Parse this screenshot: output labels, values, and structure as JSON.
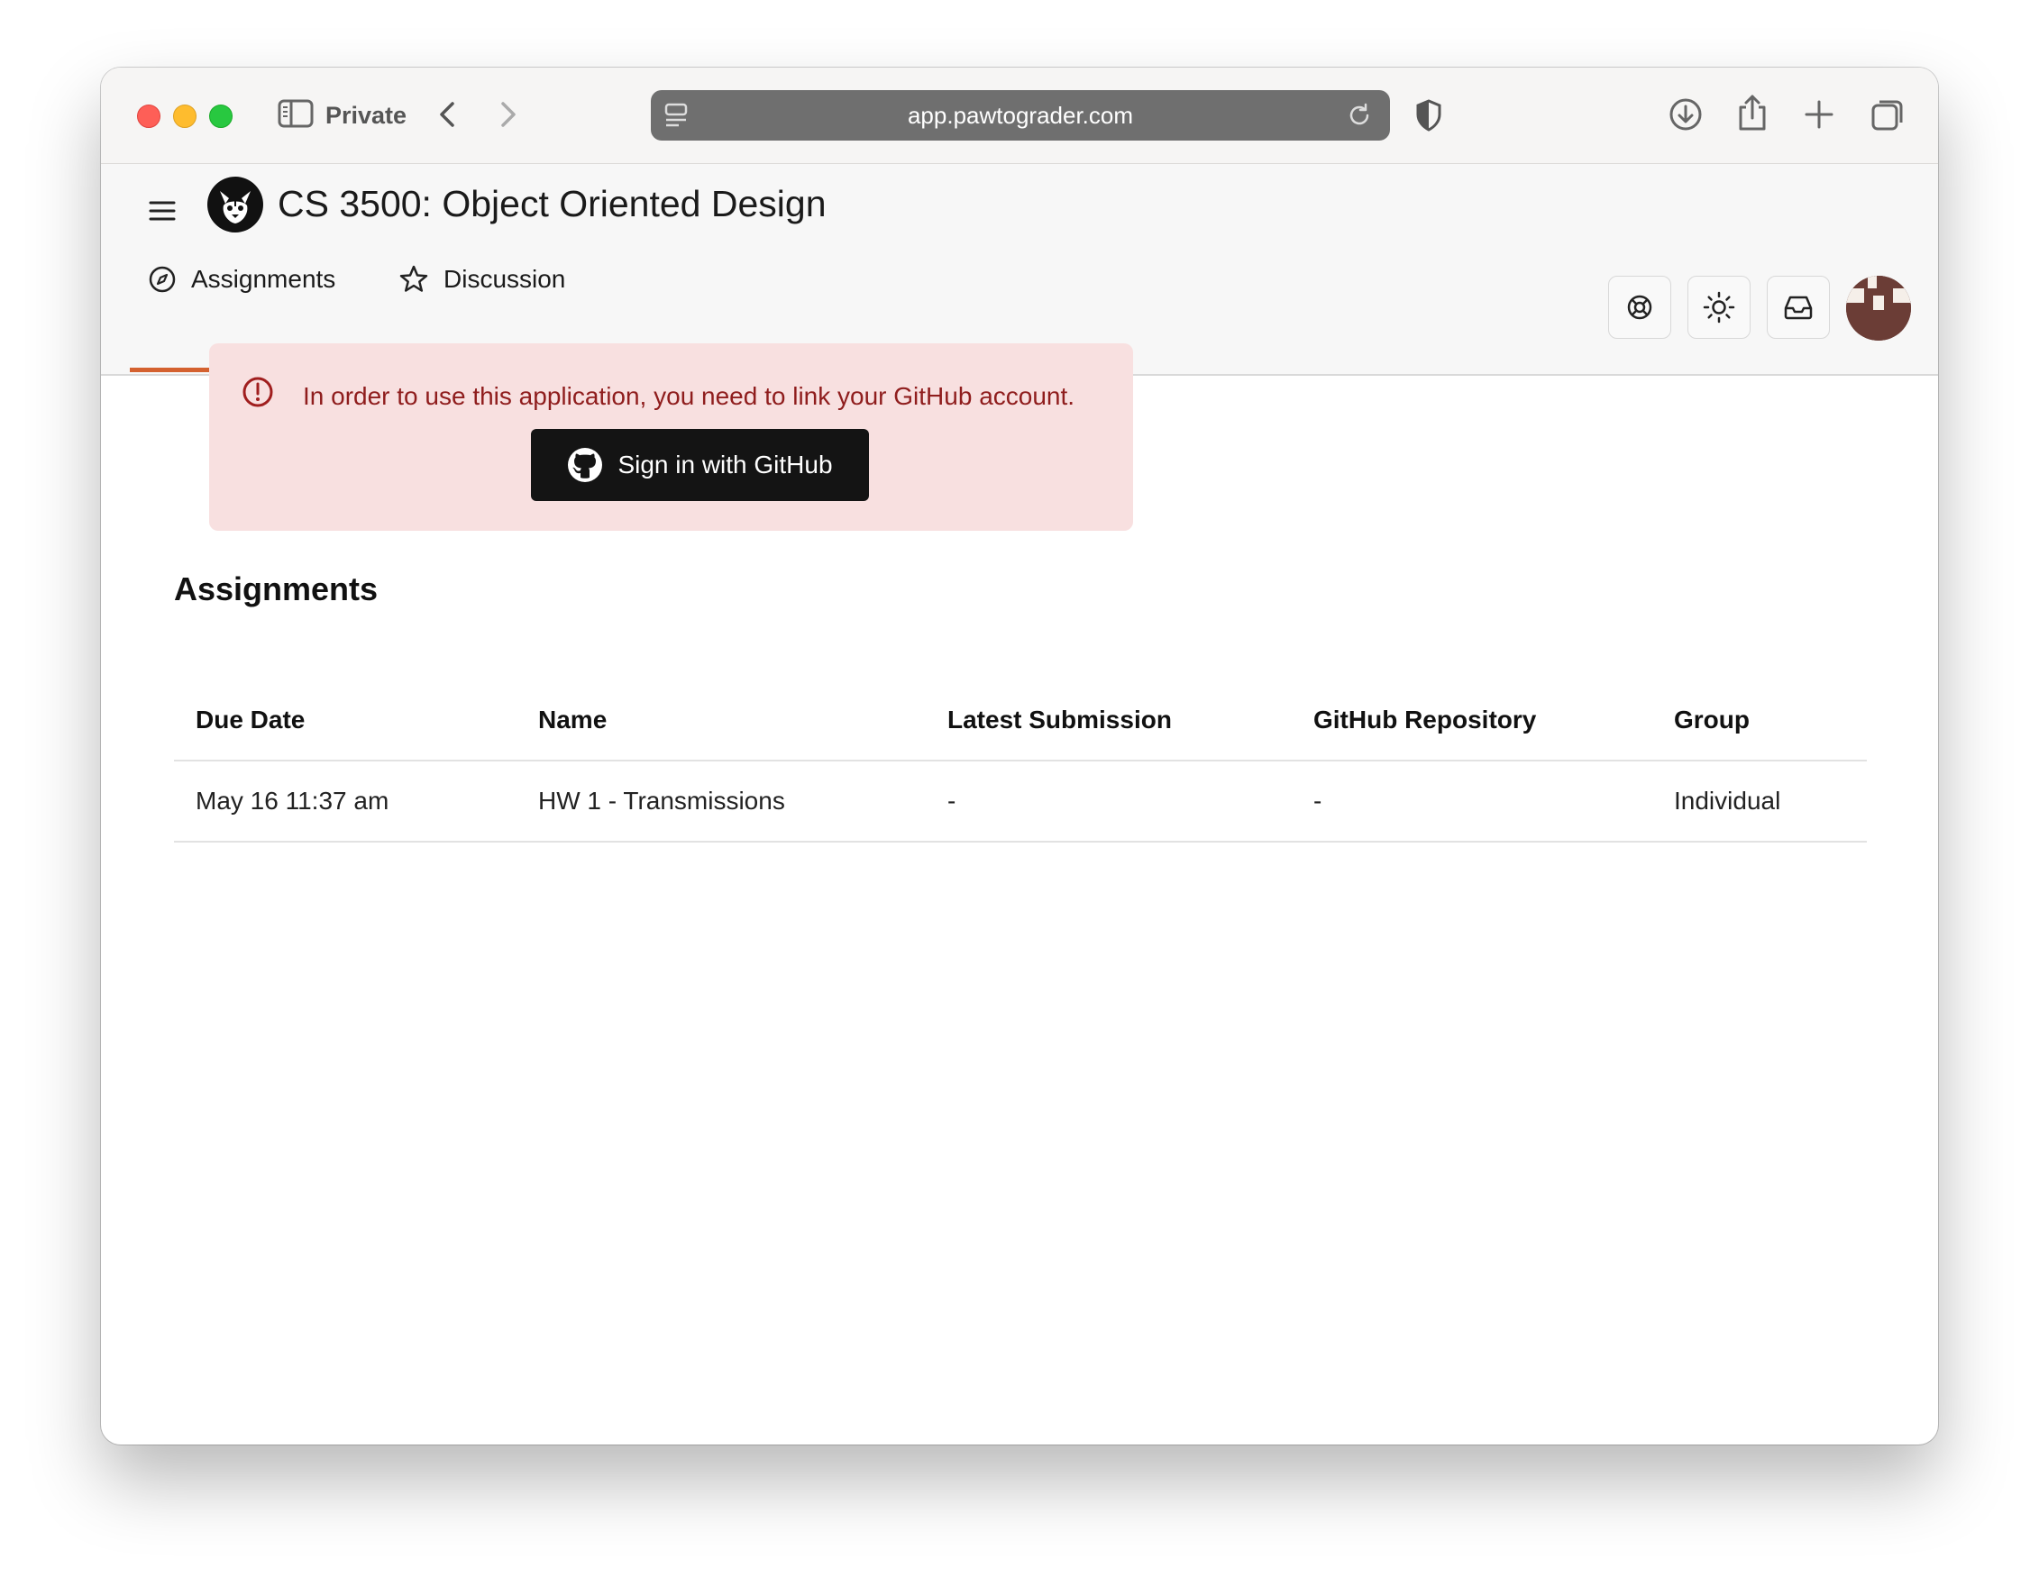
{
  "browser": {
    "private_label": "Private",
    "url": "app.pawtograder.com"
  },
  "header": {
    "course_title": "CS 3500: Object Oriented Design",
    "tabs": [
      {
        "label": "Assignments",
        "active": true
      },
      {
        "label": "Discussion",
        "active": false
      }
    ]
  },
  "alert": {
    "message": "In order to use this application, you need to link your GitHub account.",
    "button_label": "Sign in with GitHub"
  },
  "assignments": {
    "title": "Assignments",
    "columns": [
      "Due Date",
      "Name",
      "Latest Submission",
      "GitHub Repository",
      "Group"
    ],
    "rows": [
      {
        "due_date": "May 16 11:37 am",
        "name": "HW 1 - Transmissions",
        "latest_submission": "-",
        "github_repository": "-",
        "group": "Individual"
      }
    ]
  },
  "colors": {
    "accent": "#d4612f",
    "alert_bg": "#f8e0e0",
    "alert_text": "#8f1d1d"
  }
}
